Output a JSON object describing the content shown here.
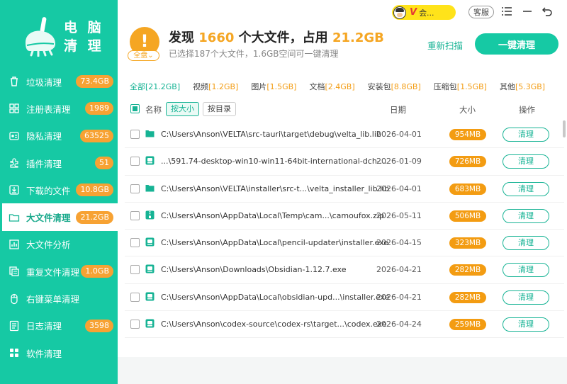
{
  "sidebar": {
    "logo_text_line1": "电 脑",
    "logo_text_line2": "清 理",
    "items": [
      {
        "label": "垃圾清理",
        "badge": "73.4GB",
        "icon": "trash-icon"
      },
      {
        "label": "注册表清理",
        "badge": "1989",
        "icon": "grid-icon"
      },
      {
        "label": "隐私清理",
        "badge": "63525",
        "icon": "privacy-icon"
      },
      {
        "label": "插件清理",
        "badge": "51",
        "icon": "plugin-icon"
      },
      {
        "label": "下载的文件",
        "badge": "10.8GB",
        "icon": "download-icon"
      },
      {
        "label": "大文件清理",
        "badge": "21.2GB",
        "icon": "folder-icon",
        "active": true
      },
      {
        "label": "大文件分析",
        "badge": "",
        "icon": "chart-icon"
      },
      {
        "label": "重复文件清理",
        "badge": "1.0GB",
        "icon": "duplicate-icon"
      },
      {
        "label": "右键菜单清理",
        "badge": "",
        "icon": "mouse-icon"
      },
      {
        "label": "日志清理",
        "badge": "3598",
        "icon": "log-icon"
      },
      {
        "label": "软件清理",
        "badge": "",
        "icon": "apps-icon"
      }
    ]
  },
  "titlebar": {
    "vip_mark": "V",
    "vip_text": "会...",
    "service_label": "客服"
  },
  "header": {
    "scan_tag": "全盘",
    "headline_prefix": "发现 ",
    "file_count": "1660",
    "headline_middle": " 个大文件，占用 ",
    "total_size": "21.2GB",
    "subline": "已选择187个大文件，1.6GB空间可一键清理",
    "rescan_label": "重新扫描",
    "clean_all_label": "一键清理"
  },
  "tabs": [
    {
      "label": "全部",
      "size": "[21.2GB]",
      "active": true
    },
    {
      "label": "视频",
      "size": "[1.2GB]"
    },
    {
      "label": "图片",
      "size": "[1.5GB]"
    },
    {
      "label": "文档",
      "size": "[2.4GB]"
    },
    {
      "label": "安装包",
      "size": "[8.8GB]"
    },
    {
      "label": "压缩包",
      "size": "[1.5GB]"
    },
    {
      "label": "其他",
      "size": "[5.3GB]"
    }
  ],
  "list_header": {
    "name": "名称",
    "sort_by_size": "按大小",
    "sort_by_dir": "按目录",
    "date": "日期",
    "size": "大小",
    "op": "操作"
  },
  "rows": [
    {
      "path": "C:\\Users\\Anson\\VELTA\\src-tauri\\target\\debug\\velta_lib.lib",
      "date": "2026-04-01",
      "size": "954MB",
      "action": "清理",
      "icon": "folder-icon"
    },
    {
      "path": "...\\591.74-desktop-win10-win11-64bit-international-dch-...",
      "date": "2026-01-09",
      "size": "726MB",
      "action": "清理",
      "icon": "installer-icon"
    },
    {
      "path": "C:\\Users\\Anson\\VELTA\\installer\\src-t...\\velta_installer_lib.lib",
      "date": "2026-04-01",
      "size": "683MB",
      "action": "清理",
      "icon": "folder-icon"
    },
    {
      "path": "C:\\Users\\Anson\\AppData\\Local\\Temp\\cam...\\camoufox.zip",
      "date": "2026-05-11",
      "size": "506MB",
      "action": "清理",
      "icon": "zip-icon"
    },
    {
      "path": "C:\\Users\\Anson\\AppData\\Local\\pencil-updater\\installer.exe",
      "date": "2026-04-15",
      "size": "323MB",
      "action": "清理",
      "icon": "installer-icon"
    },
    {
      "path": "C:\\Users\\Anson\\Downloads\\Obsidian-1.12.7.exe",
      "date": "2026-04-21",
      "size": "282MB",
      "action": "清理",
      "icon": "installer-icon"
    },
    {
      "path": "C:\\Users\\Anson\\AppData\\Local\\obsidian-upd...\\installer.exe",
      "date": "2026-04-21",
      "size": "282MB",
      "action": "清理",
      "icon": "installer-icon"
    },
    {
      "path": "C:\\Users\\Anson\\codex-source\\codex-rs\\target...\\codex.exe",
      "date": "2026-04-24",
      "size": "259MB",
      "action": "清理",
      "icon": "installer-icon"
    }
  ],
  "colors": {
    "brand": "#16c9a4",
    "accent_orange": "#f39c12",
    "warning": "#f5a623"
  }
}
